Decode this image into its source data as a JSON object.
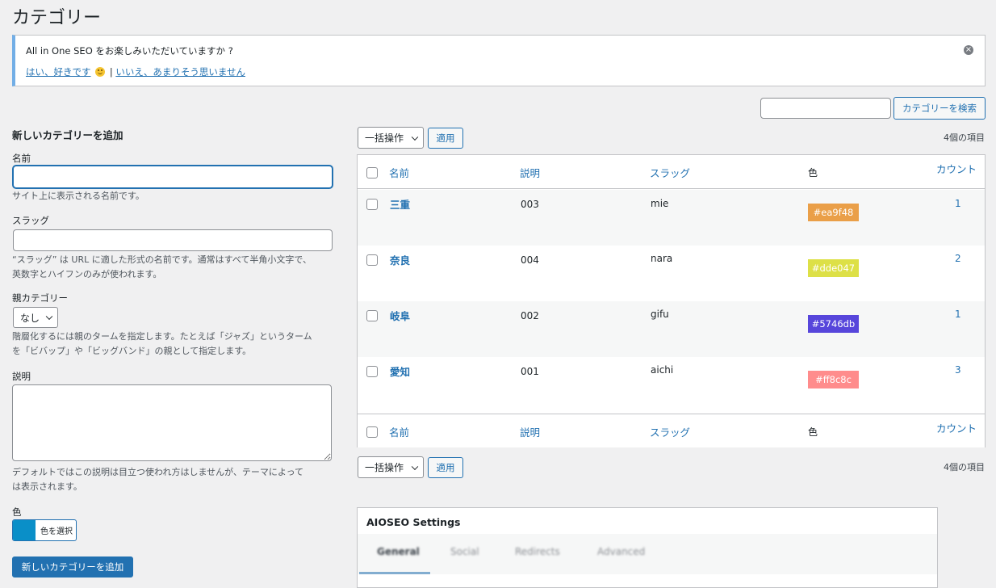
{
  "page": {
    "title": "カテゴリー"
  },
  "notice": {
    "question": "All in One SEO をお楽しみいただいていますか ?",
    "yes_link": "はい、好きです",
    "separator": "|",
    "no_link": "いいえ、あまりそう思いません",
    "dismiss_icon": "circle-x-icon"
  },
  "search": {
    "placeholder": "",
    "button_label": "カテゴリーを検索"
  },
  "add_form": {
    "heading": "新しいカテゴリーを追加",
    "name_label": "名前",
    "name_value": "",
    "name_help": "サイト上に表示される名前です。",
    "slug_label": "スラッグ",
    "slug_value": "",
    "slug_help_1": "“スラッグ” は URL に適した形式の名前です。通常はすべて半角小文字で、",
    "slug_help_2": "英数字とハイフンのみが使われます。",
    "parent_label": "親カテゴリー",
    "parent_selected": "なし",
    "parent_help_1": "階層化するには親のタームを指定します。たとえば「ジャズ」というターム",
    "parent_help_2": "を「ビバップ」や「ビッグバンド」の親として指定します。",
    "desc_label": "説明",
    "desc_value": "",
    "desc_help_1": "デフォルトではこの説明は目立つ使われ方はしませんが、テーマによって",
    "desc_help_2": "は表示されます。",
    "color_label": "色",
    "color_button": "色を選択",
    "color_value": "#0a8fc8",
    "submit_label": "新しいカテゴリーを追加"
  },
  "bulk": {
    "selected": "一括操作",
    "apply": "適用"
  },
  "items_count": "4個の項目",
  "table": {
    "columns": {
      "name": "名前",
      "description": "説明",
      "slug": "スラッグ",
      "color": "色",
      "count": "カウント"
    },
    "rows": [
      {
        "name": "三重",
        "description": "003",
        "slug": "mie",
        "color": "#ea9f48",
        "count": "1"
      },
      {
        "name": "奈良",
        "description": "004",
        "slug": "nara",
        "color": "#dde047",
        "count": "2"
      },
      {
        "name": "岐阜",
        "description": "002",
        "slug": "gifu",
        "color": "#5746db",
        "count": "1"
      },
      {
        "name": "愛知",
        "description": "001",
        "slug": "aichi",
        "color": "#ff8c8c",
        "count": "3"
      }
    ]
  },
  "aioseo": {
    "title": "AIOSEO Settings",
    "tabs": [
      "General",
      "Social",
      "Redirects",
      "Advanced"
    ]
  }
}
